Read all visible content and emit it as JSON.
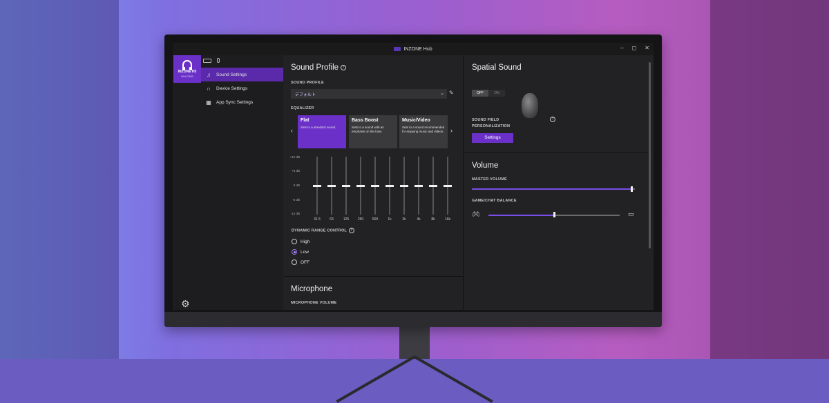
{
  "window": {
    "title": "INZONE Hub",
    "controls": [
      "–",
      "◻",
      "✕"
    ]
  },
  "sidebar": {
    "device": {
      "name": "INZONE H5",
      "model": "WH-G500"
    },
    "items": [
      {
        "label": "Sound Settings",
        "icon": "music-note-icon",
        "active": true
      },
      {
        "label": "Device Settings",
        "icon": "headphones-icon",
        "active": false
      },
      {
        "label": "App Sync Settings",
        "icon": "grid-icon",
        "active": false
      }
    ]
  },
  "sound_profile": {
    "heading": "Sound Profile",
    "profile_label": "SOUND PROFILE",
    "profile_value": "デフォルト",
    "equalizer_label": "EQUALIZER",
    "presets": [
      {
        "title": "Flat",
        "desc": "Sets to a standard sound.",
        "active": true
      },
      {
        "title": "Bass Boost",
        "desc": "Sets to a sound with an emphasis on the lows.",
        "active": false
      },
      {
        "title": "Music/Video",
        "desc": "Sets to a sound recommended for enjoying music and videos.",
        "active": false
      }
    ],
    "db_labels": [
      "+12 dB",
      "+6 dB",
      "0 dB",
      "-6 dB",
      "-12 dB"
    ],
    "frequencies": [
      "31.5",
      "63",
      "125",
      "250",
      "500",
      "1k",
      "2k",
      "4k",
      "8k",
      "16k"
    ],
    "eq_values": [
      0,
      0,
      0,
      0,
      0,
      0,
      0,
      0,
      0,
      0
    ],
    "drc_label": "DYNAMIC RANGE CONTROL",
    "drc_options": [
      {
        "label": "High",
        "selected": false
      },
      {
        "label": "Low",
        "selected": true
      },
      {
        "label": "OFF",
        "selected": false
      }
    ]
  },
  "microphone": {
    "heading": "Microphone",
    "volume_label": "MICROPHONE VOLUME"
  },
  "spatial": {
    "heading": "Spatial Sound",
    "toggle_off": "OFF",
    "toggle_on": "ON",
    "state": "OFF",
    "personalization_label_1": "SOUND FIELD",
    "personalization_label_2": "PERSONALIZATION",
    "settings_button": "Settings"
  },
  "volume": {
    "heading": "Volume",
    "master_label": "MASTER VOLUME",
    "master_value": 0.98,
    "balance_label": "GAME/CHAT BALANCE",
    "balance_value": 0.5
  },
  "colors": {
    "accent": "#6a30c8",
    "background": "#222224",
    "sidebar": "#1d1d1f"
  }
}
